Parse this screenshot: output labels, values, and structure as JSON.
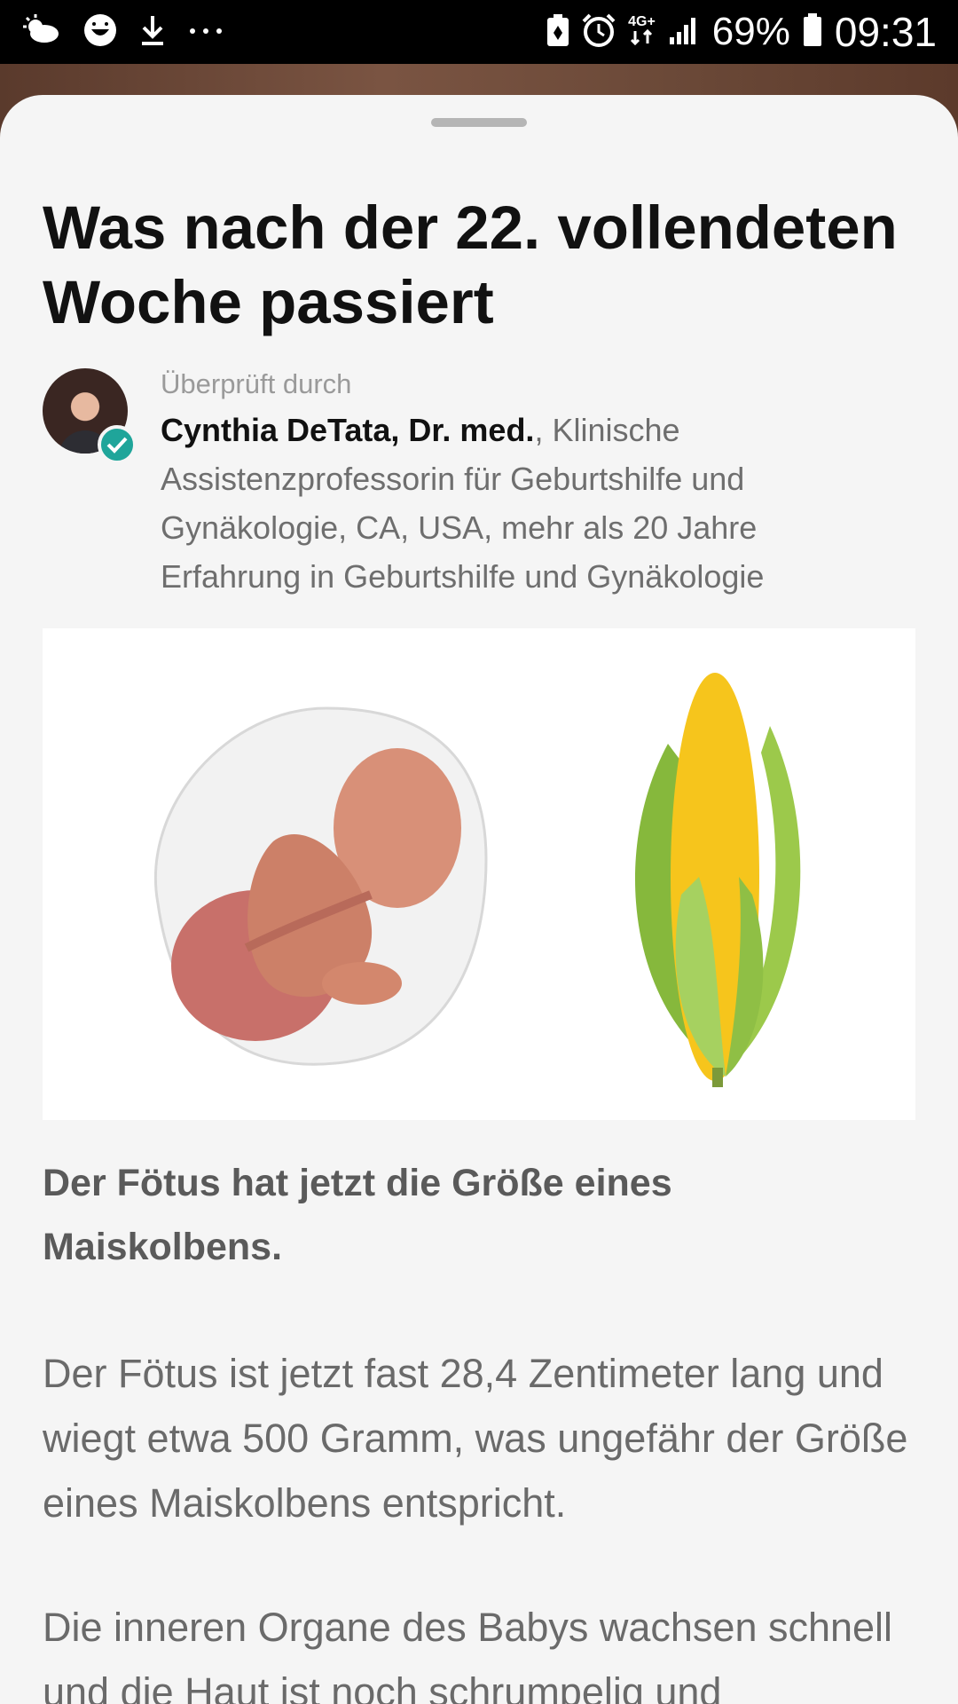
{
  "status_bar": {
    "network": "4G+",
    "battery": "69%",
    "time": "09:31",
    "icons_left": [
      "weather-icon",
      "face-icon",
      "download-icon",
      "more-icon"
    ],
    "icons_right": [
      "battery-saver-icon",
      "alarm-icon",
      "network-icon",
      "signal-icon",
      "battery-icon"
    ]
  },
  "article": {
    "title": "Was nach der 22. vollendeten Woche passiert",
    "reviewed_label": "Überprüft durch",
    "author_name": "Cynthia DeTata, Dr. med.",
    "author_credentials": ", Klinische Assistenzprofessorin für Geburtshilfe und Gynäkologie, CA, USA, mehr als 20 Jahre Erfahrung in Geburtshilfe und Gynäkologie",
    "lead": "Der Fötus hat jetzt die Größe eines Maiskolbens.",
    "paragraph_1": "Der Fötus ist jetzt fast 28,4 Zentimeter lang und wiegt etwa 500 Gramm, was ungefähr der Größe eines Maiskolbens entspricht.",
    "paragraph_2": "Die inneren Organe des Babys wachsen schnell und die Haut ist noch schrumpelig und"
  },
  "colors": {
    "accent_verified": "#1fa59a",
    "sheet_background": "#f5f5f5"
  }
}
